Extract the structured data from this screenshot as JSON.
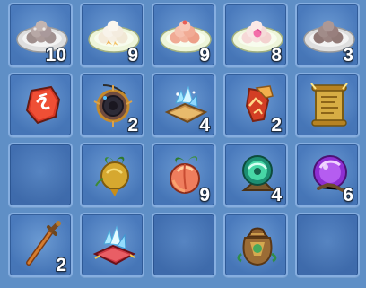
{
  "inventory": {
    "rows": [
      [
        {
          "name": "dumpling-plate-grey-icon",
          "count": "10"
        },
        {
          "name": "dumpling-plate-white-icon",
          "count": "9"
        },
        {
          "name": "dumpling-plate-pink-icon",
          "count": "9"
        },
        {
          "name": "dumpling-plate-rose-icon",
          "count": "8"
        },
        {
          "name": "dumpling-plate-dark-icon",
          "count": "3"
        }
      ],
      [
        {
          "name": "red-rune-stone-icon",
          "count": ""
        },
        {
          "name": "dark-amulet-icon",
          "count": "2"
        },
        {
          "name": "crystal-cushion-icon",
          "count": "4"
        },
        {
          "name": "red-fragment-icon",
          "count": "2"
        },
        {
          "name": "golden-scroll-icon",
          "count": ""
        }
      ],
      [
        {
          "name": "empty-slot",
          "count": ""
        },
        {
          "name": "gold-turnip-icon",
          "count": ""
        },
        {
          "name": "peach-fruit-icon",
          "count": "9"
        },
        {
          "name": "green-orb-icon",
          "count": "4"
        },
        {
          "name": "purple-orb-icon",
          "count": "6"
        }
      ],
      [
        {
          "name": "bronze-sword-icon",
          "count": "2"
        },
        {
          "name": "crystal-cushion-icon",
          "count": ""
        },
        {
          "name": "empty-slot",
          "count": ""
        },
        {
          "name": "treasure-bag-icon",
          "count": ""
        },
        {
          "name": "empty-slot",
          "count": ""
        }
      ]
    ]
  }
}
